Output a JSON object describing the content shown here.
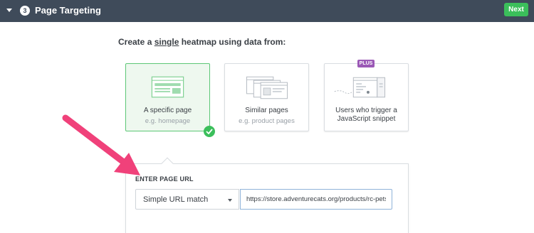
{
  "header": {
    "step_number": "3",
    "title": "Page Targeting",
    "next_label": "Next",
    "icons": [
      "chevron-down-icon",
      "step-number-badge"
    ]
  },
  "heading": {
    "prefix": "Create a ",
    "underlined": "single",
    "suffix": " heatmap using data from:"
  },
  "options": [
    {
      "title": "A specific page",
      "subtitle": "e.g. homepage",
      "selected": true,
      "icon": "single-page-icon"
    },
    {
      "title": "Similar pages",
      "subtitle": "e.g. product pages",
      "selected": false,
      "icon": "multiple-pages-icon"
    },
    {
      "title_line1": "Users who trigger a",
      "title_line2": "JavaScript snippet",
      "badge": "PLUS",
      "selected": false,
      "icon": "javascript-snippet-icon"
    }
  ],
  "url_panel": {
    "label": "ENTER PAGE URL",
    "match_type": "Simple URL match",
    "url_value": "https://store.adventurecats.org/products/rc-pets-a"
  },
  "colors": {
    "header_bg": "#3f4b5a",
    "accent_green": "#3bbf5b",
    "plus_purple": "#9b59b6",
    "annotation_arrow": "#f0417a"
  }
}
